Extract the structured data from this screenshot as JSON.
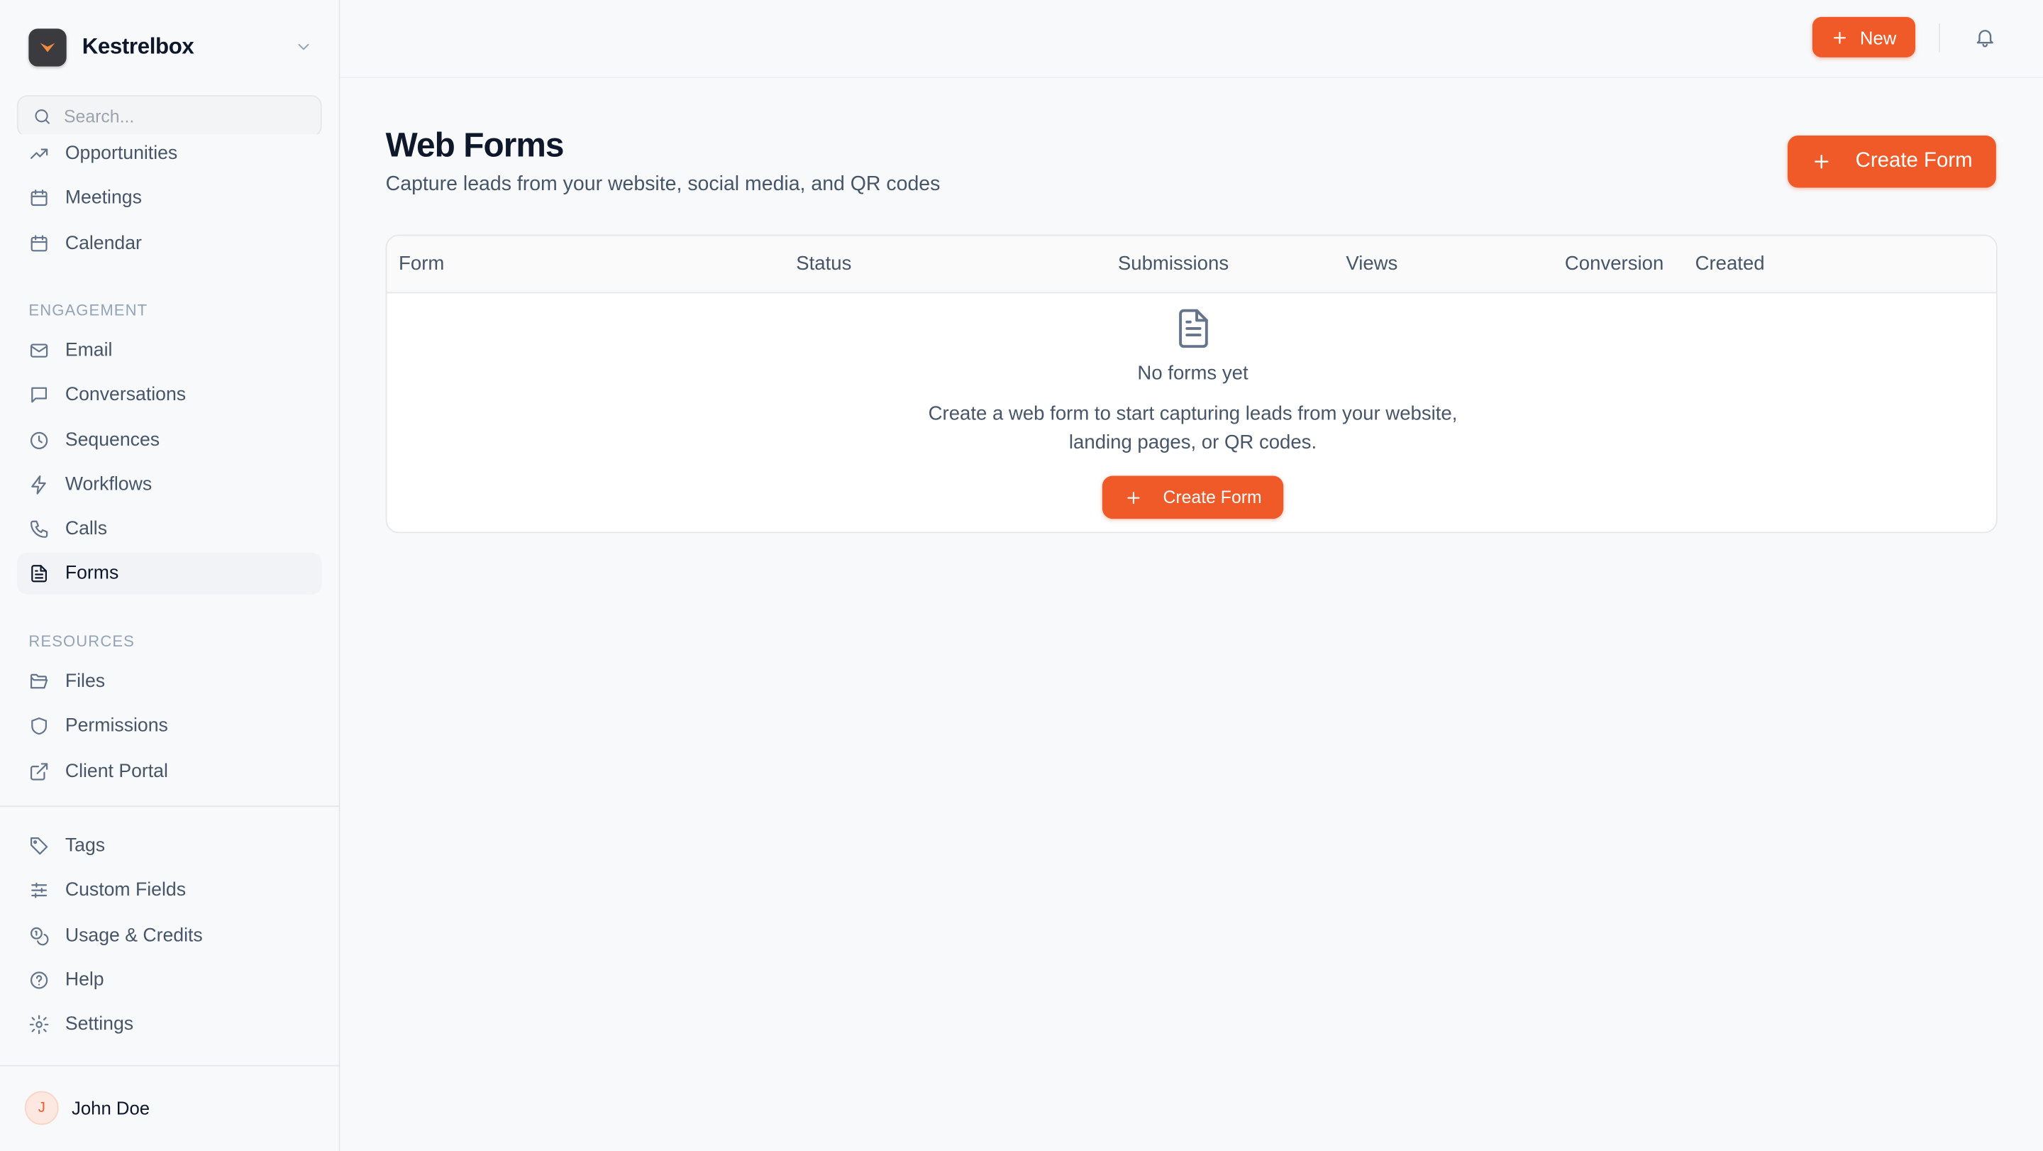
{
  "app": {
    "name": "Kestrelbox",
    "brand_color": "#f05a28"
  },
  "search": {
    "placeholder": "Search..."
  },
  "sidebar": {
    "items_top": [
      {
        "label": "Opportunities",
        "icon": "trending-up-icon"
      },
      {
        "label": "Meetings",
        "icon": "calendar-icon"
      },
      {
        "label": "Calendar",
        "icon": "calendar-icon"
      }
    ],
    "engagement_title": "ENGAGEMENT",
    "engagement": [
      {
        "label": "Email",
        "icon": "mail-icon"
      },
      {
        "label": "Conversations",
        "icon": "message-square-icon"
      },
      {
        "label": "Sequences",
        "icon": "clock-icon"
      },
      {
        "label": "Workflows",
        "icon": "zap-icon"
      },
      {
        "label": "Calls",
        "icon": "phone-icon"
      },
      {
        "label": "Forms",
        "icon": "file-text-icon",
        "active": true
      }
    ],
    "resources_title": "RESOURCES",
    "resources": [
      {
        "label": "Files",
        "icon": "folder-open-icon"
      },
      {
        "label": "Permissions",
        "icon": "shield-icon"
      },
      {
        "label": "Client Portal",
        "icon": "external-link-icon"
      }
    ],
    "bottom": [
      {
        "label": "Tags",
        "icon": "tag-icon"
      },
      {
        "label": "Custom Fields",
        "icon": "sliders-icon"
      },
      {
        "label": "Usage & Credits",
        "icon": "coins-icon"
      },
      {
        "label": "Help",
        "icon": "help-circle-icon"
      },
      {
        "label": "Settings",
        "icon": "settings-icon"
      }
    ]
  },
  "user": {
    "initial": "J",
    "name": "John Doe"
  },
  "topbar": {
    "new_label": "New"
  },
  "page": {
    "title": "Web Forms",
    "subtitle": "Capture leads from your website, social media, and QR codes",
    "create_label": "Create Form"
  },
  "table": {
    "columns": [
      "Form",
      "Status",
      "Submissions",
      "Views",
      "Conversion",
      "Created"
    ]
  },
  "empty": {
    "title": "No forms yet",
    "description": "Create a web form to start capturing leads from your website, landing pages, or QR codes.",
    "button_label": "Create Form"
  }
}
